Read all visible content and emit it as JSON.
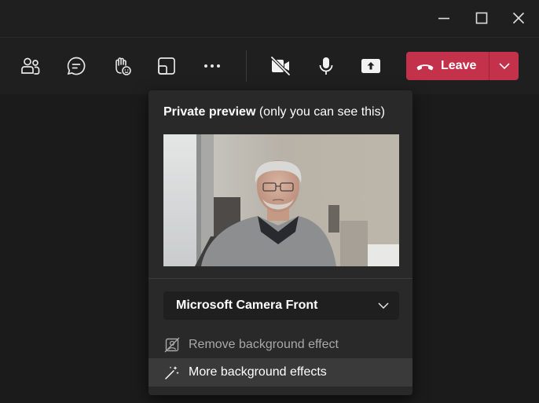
{
  "window": {
    "controls": [
      "minimize-icon",
      "maximize-icon",
      "close-icon"
    ]
  },
  "toolbar": {
    "buttons": [
      "people-icon",
      "chat-icon",
      "raise-hand-icon",
      "rooms-icon",
      "more-options-icon",
      "camera-off-icon",
      "microphone-icon",
      "share-screen-icon"
    ],
    "leave_label": "Leave",
    "leave_color": "#c4314b"
  },
  "panel": {
    "title_bold": "Private preview",
    "title_rest": " (only you can see this)",
    "camera_select_value": "Microsoft Camera Front",
    "menu": {
      "remove_bg_label": "Remove background effect",
      "more_bg_label": "More background effects"
    }
  }
}
